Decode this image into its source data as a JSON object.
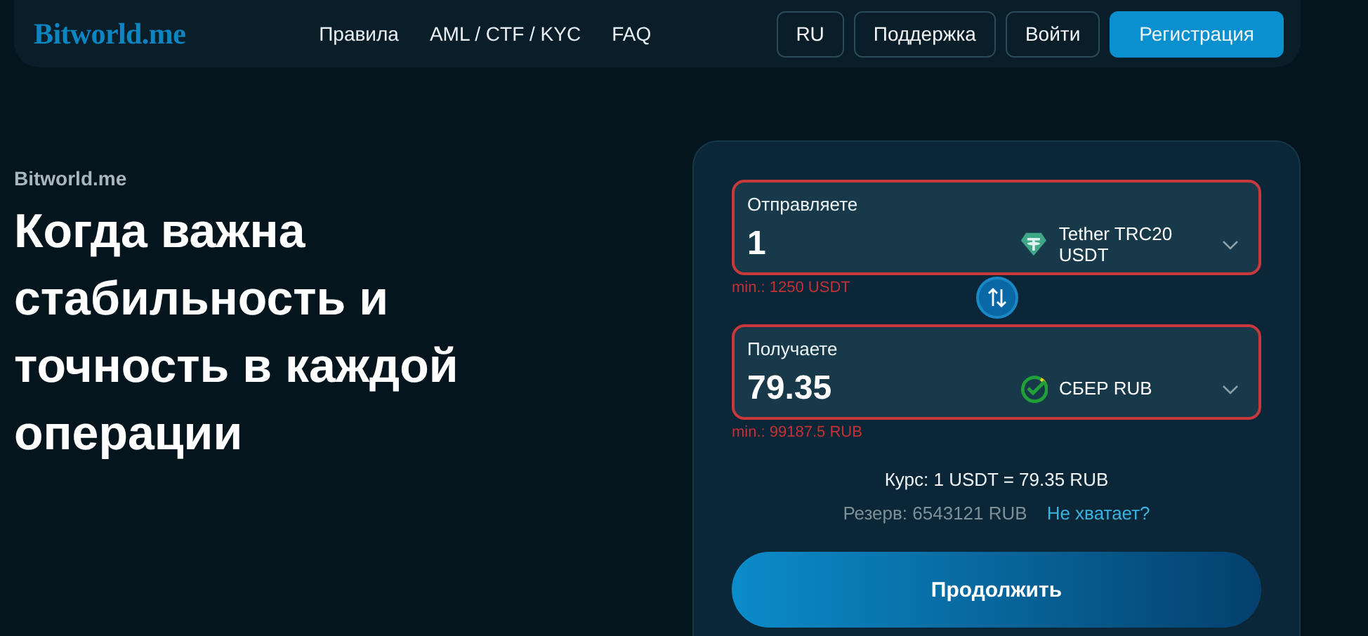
{
  "header": {
    "logo": "Bitworld.me",
    "nav": [
      "Правила",
      "AML / CTF / KYC",
      "FAQ"
    ],
    "buttons": [
      {
        "label": "RU",
        "primary": false
      },
      {
        "label": "Поддержка",
        "primary": false
      },
      {
        "label": "Войти",
        "primary": false
      },
      {
        "label": "Регистрация",
        "primary": true
      }
    ]
  },
  "hero": {
    "eyebrow": "Bitworld.me",
    "title": "Когда важна стабильность и точность в каждой операции"
  },
  "exchange": {
    "fields": [
      {
        "label": "Отправляете",
        "value": "1",
        "kind": "tether",
        "currency": "Tether TRC20 USDT",
        "invalid": true,
        "hint": "min.: 1250 USDT"
      },
      {
        "label": "Получаете",
        "value": "79.35",
        "kind": "sber",
        "currency": "СБЕР RUB",
        "invalid": true,
        "hint": "min.: 99187.5 RUB"
      }
    ],
    "rate": "Курс: 1 USDT = 79.35 RUB",
    "reserve": "Резерв: 6543121 RUB",
    "reserve_link": "Не хватает?",
    "submit": "Продолжить"
  }
}
